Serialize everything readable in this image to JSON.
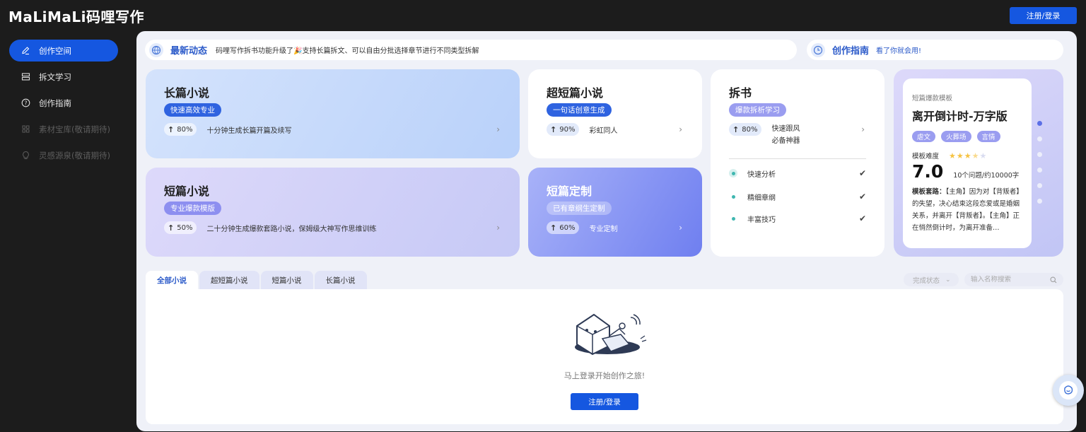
{
  "header": {
    "logo_text": "MaLiMaLi码哩写作",
    "login_label": "注册/登录"
  },
  "sidebar": {
    "items": [
      {
        "label": "创作空间",
        "icon": "pen-icon",
        "active": true
      },
      {
        "label": "拆文学习",
        "icon": "book-stack-icon",
        "active": false
      },
      {
        "label": "创作指南",
        "icon": "help-circle-icon",
        "active": false
      },
      {
        "label": "素材宝库(敬请期待)",
        "icon": "grid-icon",
        "disabled": true
      },
      {
        "label": "灵感源泉(敬请期待)",
        "icon": "bulb-icon",
        "disabled": true
      }
    ]
  },
  "news": {
    "title": "最新动态",
    "text": "码哩写作拆书功能升级了🎉支持长篇拆文、可以自由分批选择章节进行不同类型拆解"
  },
  "guide": {
    "title": "创作指南",
    "link": "看了你就会用!"
  },
  "cards": {
    "long": {
      "title": "长篇小说",
      "tag": "快速高效专业",
      "percent": "80%",
      "desc": "十分钟生成长篇开篇及续写"
    },
    "short": {
      "title": "短篇小说",
      "tag": "专业爆款模版",
      "percent": "50%",
      "desc": "二十分钟生成爆款套路小说，保姆级大神写作思维训练"
    },
    "ultra": {
      "title": "超短篇小说",
      "tag": "一句话创意生成",
      "percent": "90%",
      "desc": "彩虹同人"
    },
    "custom": {
      "title": "短篇定制",
      "tag": "已有章纲生定制",
      "percent": "60%",
      "desc": "专业定制"
    },
    "book": {
      "title": "拆书",
      "tag": "爆款拆析学习",
      "percent": "80%",
      "desc_line1": "快速跟风",
      "desc_line2": "必备神器",
      "features": [
        "快速分析",
        "精细章纲",
        "丰富技巧"
      ]
    }
  },
  "template": {
    "label": "短篇爆款模板",
    "title": "离开倒计时-万字版",
    "tags": [
      "虐文",
      "火葬场",
      "言情"
    ],
    "difficulty_label": "模板难度",
    "rating": 3.5,
    "score": "7.0",
    "meta": "10个问题/约10000字",
    "desc_label": "模板套路：",
    "desc": "【主角】因为对【背叛者】的失望，决心结束这段恋爱或是婚姻关系，并离开【背叛者】。【主角】正在悄然倒计时，为离开准备…",
    "carousel_count": 6,
    "carousel_active": 0
  },
  "tabs": [
    "全部小说",
    "超短篇小说",
    "短篇小说",
    "长篇小说"
  ],
  "filter": {
    "status_label": "完成状态"
  },
  "search": {
    "placeholder": "输入名称搜索"
  },
  "empty": {
    "text": "马上登录开始创作之旅!",
    "button": "注册/登录"
  },
  "colors": {
    "accent": "#1557e0",
    "brand_text": "#2b5ac9"
  }
}
